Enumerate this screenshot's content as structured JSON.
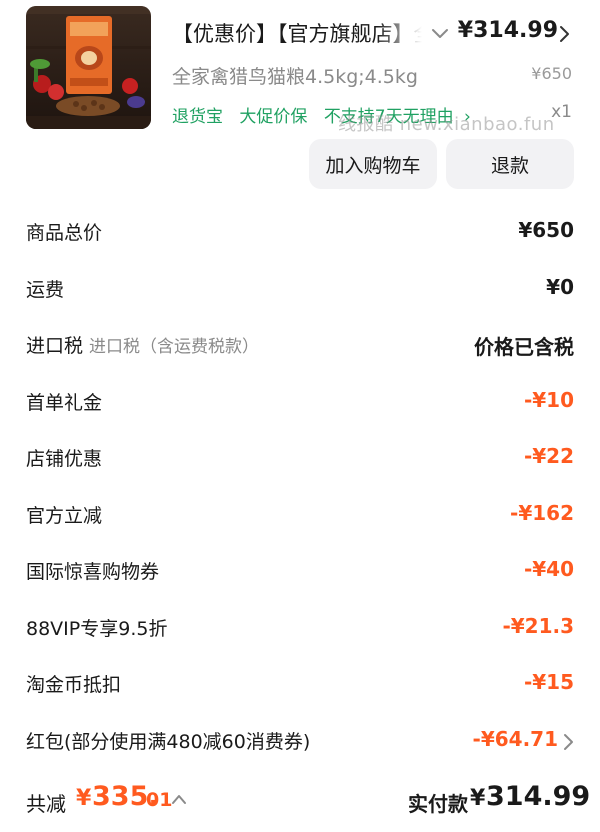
{
  "product": {
    "title": "【优惠价】【官方旗舰店】全家禽猎鸟猫粮",
    "unit_price": "¥314.99",
    "spec": "全家禽猎鸟猫粮4.5kg;4.5kg",
    "original_price": "¥650",
    "services": [
      "退货宝",
      "大促价保",
      "不支持7天无理由"
    ],
    "services_chevron": "›",
    "quantity": "x1",
    "watermark": "线报酷 new.xianbao.fun",
    "buttons": {
      "add_to_cart": "加入购物车",
      "refund": "退款"
    },
    "icons": {
      "image": "cat-food-bag-image",
      "title_expand": "chevron-down-icon",
      "price_more": "chevron-right-icon"
    }
  },
  "rows": [
    {
      "label": "商品总价",
      "sub": "",
      "value": "¥650",
      "discount": false
    },
    {
      "label": "运费",
      "sub": "",
      "value": "¥0",
      "discount": false
    },
    {
      "label": "进口税",
      "sub": "进口税（含运费税款）",
      "value": "价格已含税",
      "discount": false
    },
    {
      "label": "首单礼金",
      "sub": "",
      "value": "-¥10",
      "discount": true
    },
    {
      "label": "店铺优惠",
      "sub": "",
      "value": "-¥22",
      "discount": true
    },
    {
      "label": "官方立减",
      "sub": "",
      "value": "-¥162",
      "discount": true
    },
    {
      "label": "国际惊喜购物券",
      "sub": "",
      "value": "-¥40",
      "discount": true
    },
    {
      "label": "88VIP专享9.5折",
      "sub": "",
      "value": "-¥21.3",
      "discount": true
    },
    {
      "label": "淘金币抵扣",
      "sub": "",
      "value": "-¥15",
      "discount": true
    },
    {
      "label": "红包(部分使用满480减60消费券)",
      "sub": "",
      "value": "-¥64.71",
      "discount": true,
      "chevron": true
    }
  ],
  "footer": {
    "total_reduction_label": "共减",
    "total_reduction_currency": "¥",
    "total_reduction_int": "335.",
    "total_reduction_dec": "01",
    "paid_label": "实付款",
    "paid_currency": "¥",
    "paid_amount": "314.99"
  },
  "colors": {
    "discount": "#ff5a1f",
    "service": "#20a162",
    "button_bg": "#f2f2f4",
    "muted": "#8a8a8a"
  }
}
